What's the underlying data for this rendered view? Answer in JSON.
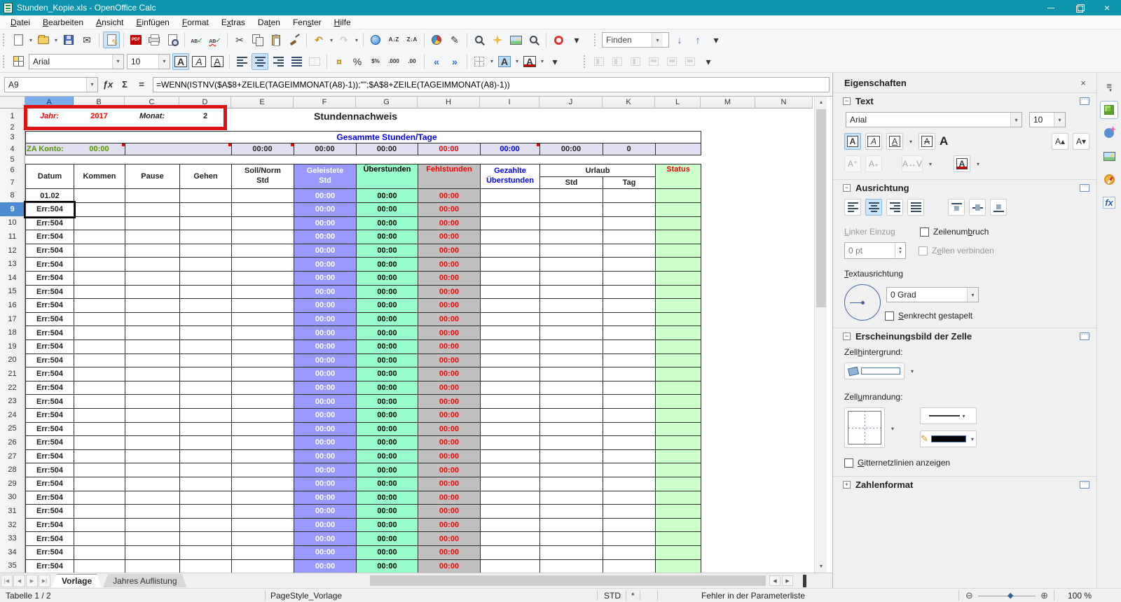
{
  "window": {
    "title": "Stunden_Kopie.xls - OpenOffice Calc",
    "controls": [
      {
        "name": "minimize"
      },
      {
        "name": "restore"
      },
      {
        "name": "close",
        "glyph": "×"
      }
    ]
  },
  "menu": {
    "items": [
      {
        "label": "Datei",
        "u": 0
      },
      {
        "label": "Bearbeiten",
        "u": 0
      },
      {
        "label": "Ansicht",
        "u": 0
      },
      {
        "label": "Einfügen",
        "u": 0
      },
      {
        "label": "Format",
        "u": 0
      },
      {
        "label": "Extras",
        "u": 1
      },
      {
        "label": "Daten",
        "u": 2
      },
      {
        "label": "Fenster",
        "u": 3
      },
      {
        "label": "Hilfe",
        "u": 0
      }
    ]
  },
  "standard_toolbar": [
    {
      "dots": true
    },
    {
      "name": "new-document",
      "shape": "doc",
      "dropdown": true
    },
    {
      "name": "open-document",
      "shape": "folder",
      "dropdown": true
    },
    {
      "name": "save",
      "shape": "floppy"
    },
    {
      "name": "document-as-email",
      "glyph": "✉"
    },
    {
      "sep": true
    },
    {
      "name": "edit-file",
      "shape": "doc-edit",
      "active": true
    },
    {
      "sep": true
    },
    {
      "name": "export-as-pdf",
      "shape": "pdf"
    },
    {
      "name": "print",
      "shape": "printer"
    },
    {
      "name": "page-preview",
      "shape": "preview"
    },
    {
      "sep": true
    },
    {
      "name": "spellcheck",
      "shape": "spell"
    },
    {
      "name": "auto-spellcheck",
      "shape": "spell-auto"
    },
    {
      "sep": true
    },
    {
      "name": "cut",
      "glyph": "✂"
    },
    {
      "name": "copy",
      "shape": "copy"
    },
    {
      "name": "paste",
      "shape": "paste"
    },
    {
      "name": "clone-formatting",
      "shape": "brush"
    },
    {
      "sep": true
    },
    {
      "name": "undo",
      "glyph": "↶",
      "cls": "g-undo",
      "dropdown": true
    },
    {
      "name": "redo",
      "glyph": "↷",
      "cls": "g-redo",
      "dropdown": true,
      "disabled": true
    },
    {
      "sep": true
    },
    {
      "name": "hyperlink",
      "shape": "globe"
    },
    {
      "name": "sort-ascending",
      "glyph": "A↓Z",
      "small": true
    },
    {
      "name": "sort-descending",
      "glyph": "Z↓A",
      "small": true
    },
    {
      "sep": true
    },
    {
      "name": "insert-chart",
      "shape": "chart"
    },
    {
      "name": "show-draw-functions",
      "glyph": "✎"
    },
    {
      "sep": true
    },
    {
      "name": "find-and-replace",
      "shape": "find"
    },
    {
      "name": "navigator",
      "shape": "navigator"
    },
    {
      "name": "gallery",
      "shape": "gallery"
    },
    {
      "name": "zoom",
      "shape": "magnifier"
    },
    {
      "sep": true
    },
    {
      "name": "help",
      "shape": "help"
    },
    {
      "name": "toolbar-options",
      "glyph": "▾",
      "overflow": true
    }
  ],
  "find_toolbar": {
    "value": "Finden",
    "buttons": [
      {
        "name": "find-next",
        "glyph": "↓",
        "cls": "g-blue"
      },
      {
        "name": "find-previous",
        "glyph": "↑",
        "cls": "g-blue"
      },
      {
        "name": "toolbar-options",
        "glyph": "▾",
        "overflow": true
      }
    ]
  },
  "format_values": {
    "font_name": "Arial",
    "font_size": "10"
  },
  "format_toolbar": [
    {
      "dots": true
    },
    {
      "name": "format-presets",
      "shape": "grid4"
    },
    {
      "combo": "font_name",
      "width": 136,
      "cname": "font-name-combo"
    },
    {
      "combo": "font_size",
      "width": 62,
      "cname": "font-size-combo"
    },
    {
      "name": "bold",
      "glyph": "A",
      "cls": "g-bold",
      "active": true
    },
    {
      "name": "italic",
      "glyph": "A",
      "cls": "g-italic"
    },
    {
      "name": "underline",
      "glyph": "A",
      "cls": "g-underline"
    },
    {
      "sep": true
    },
    {
      "name": "align-left",
      "shape": "bars bars-left"
    },
    {
      "name": "align-center",
      "shape": "bars bars-center",
      "active": true
    },
    {
      "name": "align-right",
      "shape": "bars bars-right"
    },
    {
      "name": "align-justify",
      "shape": "bars bars-justify"
    },
    {
      "name": "merge-cells",
      "shape": "merge",
      "disabled": true
    },
    {
      "sep": true
    },
    {
      "name": "currency-format",
      "glyph": "¤",
      "cls": "g-gold"
    },
    {
      "name": "percent-format",
      "glyph": "%"
    },
    {
      "name": "standard-format",
      "glyph": "$%",
      "small": true
    },
    {
      "name": "add-decimal-place",
      "glyph": ".000",
      "small": true
    },
    {
      "name": "delete-decimal-place",
      "glyph": ".00",
      "small": true
    },
    {
      "sep": true
    },
    {
      "name": "decrease-indent",
      "glyph": "«",
      "cls": "g-blue"
    },
    {
      "name": "increase-indent",
      "glyph": "»",
      "cls": "g-blue"
    },
    {
      "sep": true
    },
    {
      "name": "borders",
      "shape": "borderbox",
      "dropdown": true
    },
    {
      "name": "background-color",
      "glyph": "A",
      "cls": "g-bgcolor",
      "dropdown": true
    },
    {
      "name": "font-color",
      "glyph": "A",
      "cls": "g-fontcolor",
      "dropdown": true
    },
    {
      "name": "toolbar-options",
      "glyph": "▾",
      "overflow": true
    }
  ],
  "object_align_toolbar": [
    {
      "dots": true
    },
    {
      "name": "align-objects-left",
      "shape": "obj",
      "disabled": true
    },
    {
      "name": "center-objects-horizontally",
      "shape": "obj",
      "disabled": true
    },
    {
      "name": "align-objects-right",
      "shape": "obj",
      "disabled": true
    },
    {
      "name": "align-objects-top",
      "shape": "obj2",
      "disabled": true
    },
    {
      "name": "center-objects-vertically",
      "shape": "obj2",
      "disabled": true
    },
    {
      "name": "align-objects-bottom",
      "shape": "obj2",
      "disabled": true
    },
    {
      "name": "toolbar-options",
      "glyph": "▾",
      "overflow": true
    }
  ],
  "formula_bar": {
    "cell_reference": "A9",
    "fx_label": "ƒx",
    "sum_label": "Σ",
    "equals_label": "=",
    "formula": "=WENN(ISTNV($A$8+ZEILE(TAGEIMMONAT(A8)-1));\"\";$A$8+ZEILE(TAGEIMMONAT(A8)-1))"
  },
  "grid": {
    "column_letters": [
      "A",
      "B",
      "C",
      "D",
      "E",
      "F",
      "G",
      "H",
      "I",
      "J",
      "K",
      "L",
      "M",
      "N"
    ],
    "row_count": 35,
    "selected_column": "A",
    "selected_row": 9,
    "year_label": "Jahr:",
    "year_value": "2017",
    "month_label": "Monat:",
    "month_value": "2",
    "sheet_title": "Stundennachweis",
    "summary_title": "Gesammte Stunden/Tage",
    "za_konto_label": "ZA Konto:",
    "summary_values": {
      "za_konto": "00:00",
      "e": "00:00",
      "f": "00:00",
      "g": "00:00",
      "h": "00:00",
      "i": "00:00",
      "j": "00:00",
      "k": "0"
    },
    "table_columns": [
      {
        "key": "datum",
        "label": "Datum"
      },
      {
        "key": "kommen",
        "label": "Kommen"
      },
      {
        "key": "pause",
        "label": "Pause"
      },
      {
        "key": "gehen",
        "label": "Gehen"
      },
      {
        "key": "soll-norm-std",
        "label": "Soll/Norm Std",
        "lines": [
          "Soll/Norm",
          "Std"
        ]
      },
      {
        "key": "geleistete-std",
        "label": "Geleistete Std",
        "lines": [
          "Geleistete",
          "Std"
        ],
        "bg": "#9999FF",
        "fg": "#FFFFFF"
      },
      {
        "key": "ueberstunden",
        "label": "Überstunden",
        "bg": "#99FFCC",
        "fg": "#000000"
      },
      {
        "key": "fehlstunden",
        "label": "Fehlstunden",
        "bg": "#C0C0C0",
        "fg": "#FF0000"
      },
      {
        "key": "gezahlte-ueberstunden",
        "label": "Gezahlte Überstunden",
        "lines": [
          "Gezahlte",
          "Überstunden"
        ],
        "fg": "#0000FF"
      },
      {
        "key": "urlaub",
        "label": "Urlaub",
        "sub": [
          "Std",
          "Tag"
        ]
      },
      {
        "key": "status",
        "label": "Status",
        "bg": "#CCFFCC",
        "fg": "#FF0000"
      }
    ],
    "time_value": "00:00",
    "date_values": [
      "01.02",
      "Err:504",
      "Err:504",
      "Err:504",
      "Err:504",
      "Err:504",
      "Err:504",
      "Err:504",
      "Err:504",
      "Err:504",
      "Err:504",
      "Err:504",
      "Err:504",
      "Err:504",
      "Err:504",
      "Err:504",
      "Err:504",
      "Err:504",
      "Err:504",
      "Err:504",
      "Err:504",
      "Err:504",
      "Err:504",
      "Err:504",
      "Err:504",
      "Err:504",
      "Err:504",
      "Err:504"
    ]
  },
  "sheet_tabs": [
    {
      "label": "Vorlage",
      "active": true
    },
    {
      "label": "Jahres Auflistung",
      "active": false
    }
  ],
  "statusbar": {
    "sheet_position": "Tabelle 1 / 2",
    "page_style": "PageStyle_Vorlage",
    "selection_mode": "STD",
    "modified_flag": "*",
    "message": "Fehler in der Parameterliste",
    "zoom_level": "100 %"
  },
  "sidebar": {
    "title": "Eigenschaften",
    "text": {
      "title": "Text",
      "font_name": "Arial",
      "font_size": "10"
    },
    "ausrichtung": {
      "title": "Ausrichtung",
      "linker_einzug_label": "Linker Einzug",
      "linker_einzug_value": "0 pt",
      "zeilenumbruch_label": "Zeilenumbruch",
      "zellen_verbinden_label": "Zellen verbinden",
      "textausrichtung_label": "Textausrichtung",
      "grad_value": "0 Grad",
      "senkrecht_label": "Senkrecht gestapelt"
    },
    "erscheinungsbild": {
      "title": "Erscheinungsbild der Zelle",
      "zellhintergrund_label": "Zellhintergrund:",
      "zellumrandung_label": "Zellumrandung:",
      "gitternetz_label": "Gitternetzlinien anzeigen"
    },
    "zahlenformat": {
      "title": "Zahlenformat"
    },
    "tabs": [
      {
        "name": "properties",
        "active": true
      },
      {
        "name": "styles",
        "active": false
      },
      {
        "name": "gallery",
        "active": false
      },
      {
        "name": "navigator",
        "active": false
      },
      {
        "name": "functions",
        "active": false
      }
    ]
  },
  "colors": {
    "titlebar": "#0F94AD",
    "annotation_box": "#DE1212",
    "summary_row_bg": "#E0E0F2",
    "geleistete_bg": "#9999FF",
    "ueberstunden_bg": "#99FFCC",
    "fehlstunden_bg": "#C0C0C0",
    "status_bg": "#CCFFCC",
    "red_text": "#FF0000",
    "blue_text": "#0000FF",
    "green_text": "#569400"
  }
}
